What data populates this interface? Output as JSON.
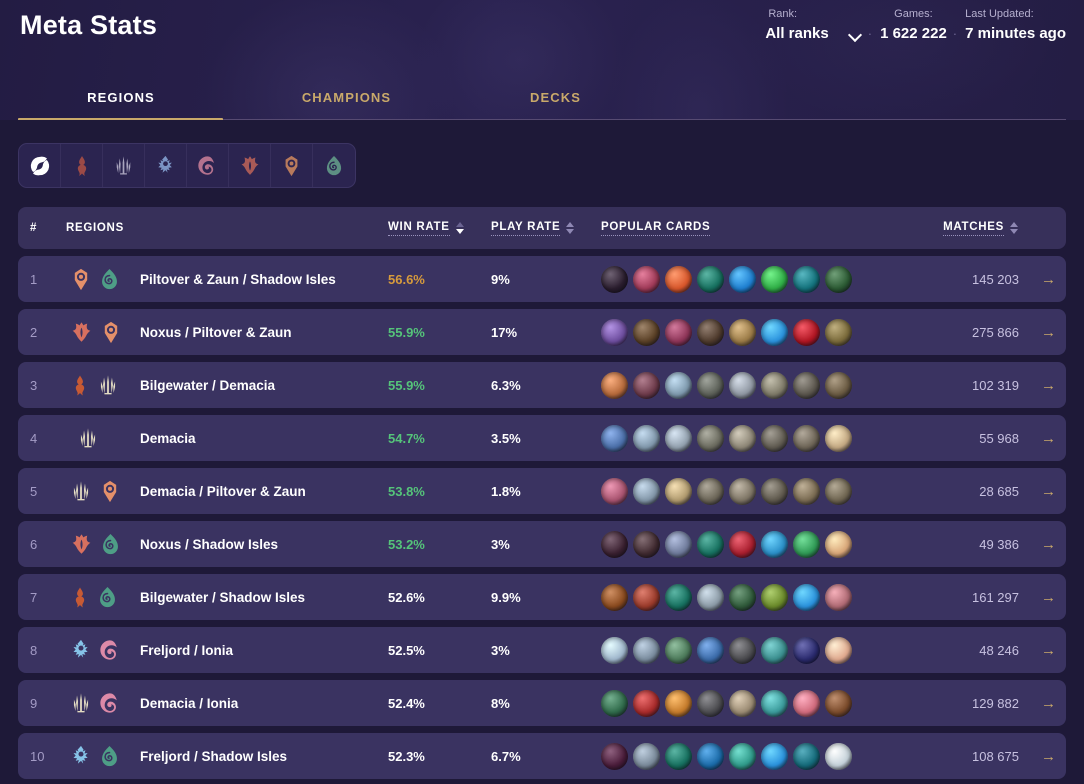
{
  "header": {
    "title": "Meta Stats",
    "rank": {
      "label": "Rank:",
      "value": "All ranks",
      "chevron_icon": "chevron-down-icon"
    },
    "games": {
      "label": "Games:",
      "value": "1 622 222"
    },
    "updated": {
      "label": "Last Updated:",
      "value": "7 minutes ago"
    },
    "separator": "·"
  },
  "tabs": [
    {
      "label": "REGIONS",
      "active": true
    },
    {
      "label": "CHAMPIONS",
      "active": false
    },
    {
      "label": "DECKS",
      "active": false
    }
  ],
  "region_filter": [
    {
      "name": "all",
      "label": "All Regions",
      "color": "#ffffff",
      "active": true
    },
    {
      "name": "bilgewater",
      "label": "Bilgewater",
      "color": "#9c4a46",
      "active": false
    },
    {
      "name": "demacia",
      "label": "Demacia",
      "color": "#a9a4bd",
      "active": false
    },
    {
      "name": "freljord",
      "label": "Freljord",
      "color": "#7b94c4",
      "active": false
    },
    {
      "name": "ionia",
      "label": "Ionia",
      "color": "#b4728e",
      "active": false
    },
    {
      "name": "noxus",
      "label": "Noxus",
      "color": "#a85a57",
      "active": false
    },
    {
      "name": "piltover",
      "label": "Piltover & Zaun",
      "color": "#b87a5c",
      "active": false
    },
    {
      "name": "shadowisles",
      "label": "Shadow Isles",
      "color": "#5d8f83",
      "active": false
    }
  ],
  "table": {
    "columns": [
      {
        "key": "rank",
        "label": "#",
        "sortable": false
      },
      {
        "key": "regions",
        "label": "REGIONS",
        "sortable": false
      },
      {
        "key": "winrate",
        "label": "WIN RATE",
        "sortable": true,
        "sorted": "desc"
      },
      {
        "key": "playrate",
        "label": "PLAY RATE",
        "sortable": true,
        "sorted": "none"
      },
      {
        "key": "cards",
        "label": "POPULAR CARDS",
        "sortable": false
      },
      {
        "key": "matches",
        "label": "MATCHES",
        "sortable": true,
        "sorted": "none"
      }
    ],
    "row_action_icon": "arrow-right-icon",
    "rows": [
      {
        "rank": "1",
        "name": "Piltover & Zaun / Shadow Isles",
        "regions": [
          "piltover",
          "shadowisles"
        ],
        "win_rate": "56.6%",
        "win_rate_tone": "gold",
        "play_rate": "9%",
        "matches": "145 203",
        "cards": [
          "#2a1d2e",
          "#a03a58",
          "#d8562a",
          "#16705f",
          "#1e7fd0",
          "#2fae46",
          "#13727c",
          "#2b5a33"
        ]
      },
      {
        "rank": "2",
        "name": "Noxus / Piltover & Zaun",
        "regions": [
          "noxus",
          "piltover"
        ],
        "win_rate": "55.9%",
        "win_rate_tone": "green",
        "play_rate": "17%",
        "matches": "275 866",
        "cards": [
          "#6d4d9e",
          "#5a4026",
          "#8d3457",
          "#4e3a2c",
          "#9a7a46",
          "#2a92dd",
          "#b01522",
          "#7a6a3a"
        ]
      },
      {
        "rank": "3",
        "name": "Bilgewater / Demacia",
        "regions": [
          "bilgewater",
          "demacia"
        ],
        "win_rate": "55.9%",
        "win_rate_tone": "green",
        "play_rate": "6.3%",
        "matches": "102 319",
        "cards": [
          "#b5693a",
          "#6d3a4a",
          "#7e99ad",
          "#5b5f57",
          "#8f97a2",
          "#7e7a68",
          "#5a554c",
          "#6a5a42"
        ]
      },
      {
        "rank": "4",
        "name": "Demacia",
        "regions": [
          "demacia"
        ],
        "win_rate": "54.7%",
        "win_rate_tone": "green",
        "play_rate": "3.5%",
        "matches": "55 968",
        "cards": [
          "#4a6ea8",
          "#8097ab",
          "#92a0ae",
          "#6a6a5e",
          "#8d8676",
          "#5f5a50",
          "#6d6456",
          "#c3a882"
        ]
      },
      {
        "rank": "5",
        "name": "Demacia / Piltover & Zaun",
        "regions": [
          "demacia",
          "piltover"
        ],
        "win_rate": "53.8%",
        "win_rate_tone": "green",
        "play_rate": "1.8%",
        "matches": "28 685",
        "cards": [
          "#a8536f",
          "#8296a8",
          "#b09a6e",
          "#6a6456",
          "#7d7464",
          "#5e584c",
          "#7a6b52",
          "#6e6450"
        ]
      },
      {
        "rank": "6",
        "name": "Noxus / Shadow Isles",
        "regions": [
          "noxus",
          "shadowisles"
        ],
        "win_rate": "53.2%",
        "win_rate_tone": "green",
        "play_rate": "3%",
        "matches": "49 386",
        "cards": [
          "#3a2030",
          "#402a30",
          "#6e7a9a",
          "#16705f",
          "#a81e2e",
          "#2a8fc8",
          "#2f9a55",
          "#d9a678"
        ]
      },
      {
        "rank": "7",
        "name": "Bilgewater / Shadow Isles",
        "regions": [
          "bilgewater",
          "shadowisles"
        ],
        "win_rate": "52.6%",
        "win_rate_tone": "white",
        "play_rate": "9.9%",
        "matches": "161 297",
        "cards": [
          "#8a4a1e",
          "#9a3a2a",
          "#16705f",
          "#8b9aa6",
          "#2f5a3a",
          "#6a8a2a",
          "#2a92dd",
          "#b06a74"
        ]
      },
      {
        "rank": "8",
        "name": "Freljord / Ionia",
        "regions": [
          "freljord",
          "ionia"
        ],
        "win_rate": "52.5%",
        "win_rate_tone": "white",
        "play_rate": "3%",
        "matches": "48 246",
        "cards": [
          "#9fb6cc",
          "#7a8c9e",
          "#4c7a5a",
          "#3a6aa8",
          "#4a4a4e",
          "#3a8e8e",
          "#2a2a6e",
          "#e0a98e"
        ]
      },
      {
        "rank": "9",
        "name": "Demacia / Ionia",
        "regions": [
          "demacia",
          "ionia"
        ],
        "win_rate": "52.4%",
        "win_rate_tone": "white",
        "play_rate": "8%",
        "matches": "129 882",
        "cards": [
          "#2f6a4a",
          "#a82a2a",
          "#c47a2a",
          "#4a4a4e",
          "#9a8a72",
          "#3a9a9a",
          "#d06a7c",
          "#7a4a2a"
        ]
      },
      {
        "rank": "10",
        "name": "Freljord / Shadow Isles",
        "regions": [
          "freljord",
          "shadowisles"
        ],
        "win_rate": "52.3%",
        "win_rate_tone": "white",
        "play_rate": "6.7%",
        "matches": "108 675",
        "cards": [
          "#4a1c3a",
          "#7a8a9a",
          "#16705f",
          "#1a6aa8",
          "#2f9a8a",
          "#2a92dd",
          "#146a7a",
          "#c5d2da"
        ]
      }
    ]
  },
  "chart_data": {
    "type": "table",
    "title": "Meta Stats - Regions",
    "columns": [
      "#",
      "REGIONS",
      "WIN RATE",
      "PLAY RATE",
      "POPULAR CARDS",
      "MATCHES"
    ],
    "rows": [
      [
        "1",
        "Piltover & Zaun / Shadow Isles",
        "56.6%",
        "9%",
        "",
        "145 203"
      ],
      [
        "2",
        "Noxus / Piltover & Zaun",
        "55.9%",
        "17%",
        "",
        "275 866"
      ],
      [
        "3",
        "Bilgewater / Demacia",
        "55.9%",
        "6.3%",
        "",
        "102 319"
      ],
      [
        "4",
        "Demacia",
        "54.7%",
        "3.5%",
        "",
        "55 968"
      ],
      [
        "5",
        "Demacia / Piltover & Zaun",
        "53.8%",
        "1.8%",
        "",
        "28 685"
      ],
      [
        "6",
        "Noxus / Shadow Isles",
        "53.2%",
        "3%",
        "",
        "49 386"
      ],
      [
        "7",
        "Bilgewater / Shadow Isles",
        "52.6%",
        "9.9%",
        "",
        "161 297"
      ],
      [
        "8",
        "Freljord / Ionia",
        "52.5%",
        "3%",
        "",
        "48 246"
      ],
      [
        "9",
        "Demacia / Ionia",
        "52.4%",
        "8%",
        "",
        "129 882"
      ],
      [
        "10",
        "Freljord / Shadow Isles",
        "52.3%",
        "6.7%",
        "",
        "108 675"
      ]
    ]
  },
  "colors": {
    "page_bg": "#1e1938",
    "row_bg": "#3a3361",
    "header_row_bg": "#37305a",
    "accent_gold": "#c9a96a",
    "win_gold": "#d79b3c",
    "win_green": "#55c47a",
    "text_muted": "#a49cc6"
  }
}
